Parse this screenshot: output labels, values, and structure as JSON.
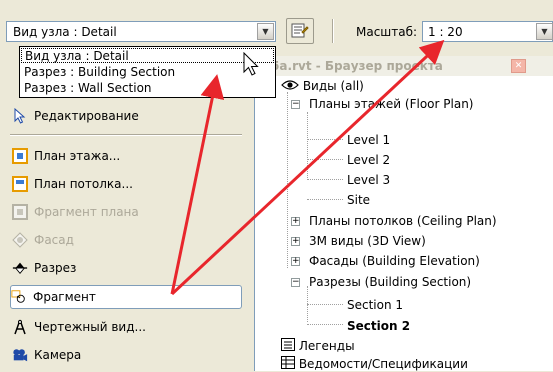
{
  "toolbar": {
    "view_type_value": "Вид узла : Detail",
    "scale_label": "Масштаб:",
    "scale_value": "1 : 20"
  },
  "dropdown": {
    "options": [
      "Вид узла : Detail",
      "Разрез : Building Section",
      "Разрез : Wall Section"
    ],
    "selected_index": 0
  },
  "tools": [
    {
      "label": "Редактирование",
      "icon": "pointer-arrow-icon",
      "enabled": true,
      "active": false
    },
    {
      "label": "План этажа...",
      "icon": "floor-plan-icon",
      "enabled": true,
      "active": false
    },
    {
      "label": "План потолка...",
      "icon": "ceiling-plan-icon",
      "enabled": true,
      "active": false
    },
    {
      "label": "Фрагмент плана",
      "icon": "plan-region-icon",
      "enabled": false,
      "active": false
    },
    {
      "label": "Фасад",
      "icon": "elevation-icon",
      "enabled": false,
      "active": false
    },
    {
      "label": "Разрез",
      "icon": "section-icon",
      "enabled": true,
      "active": false
    },
    {
      "label": "Фрагмент",
      "icon": "callout-icon",
      "enabled": true,
      "active": true
    },
    {
      "label": "Чертежный вид...",
      "icon": "drafting-view-icon",
      "enabled": true,
      "active": false
    },
    {
      "label": "Камера",
      "icon": "camera-icon",
      "enabled": true,
      "active": false
    }
  ],
  "browser": {
    "title": "t05a.rvt - Браузер проекта",
    "tree": {
      "root": "Виды (all)",
      "floor_plans": "Планы этажей (Floor Plan)",
      "floor_plan_children": [
        "Level 1",
        "Level 2",
        "Level 3",
        "Site"
      ],
      "ceiling_plans": "Планы потолков (Ceiling Plan)",
      "views_3d": "3М виды (3D View)",
      "elevations": "Фасады (Building Elevation)",
      "sections": "Разрезы (Building Section)",
      "section_children": [
        "Section 1",
        "Section 2"
      ],
      "legends": "Легенды",
      "schedules": "Ведомости/Спецификации"
    }
  },
  "colors": {
    "arrow": "#e8262c",
    "chrome": "#ece9d8",
    "border": "#7f9db9"
  }
}
